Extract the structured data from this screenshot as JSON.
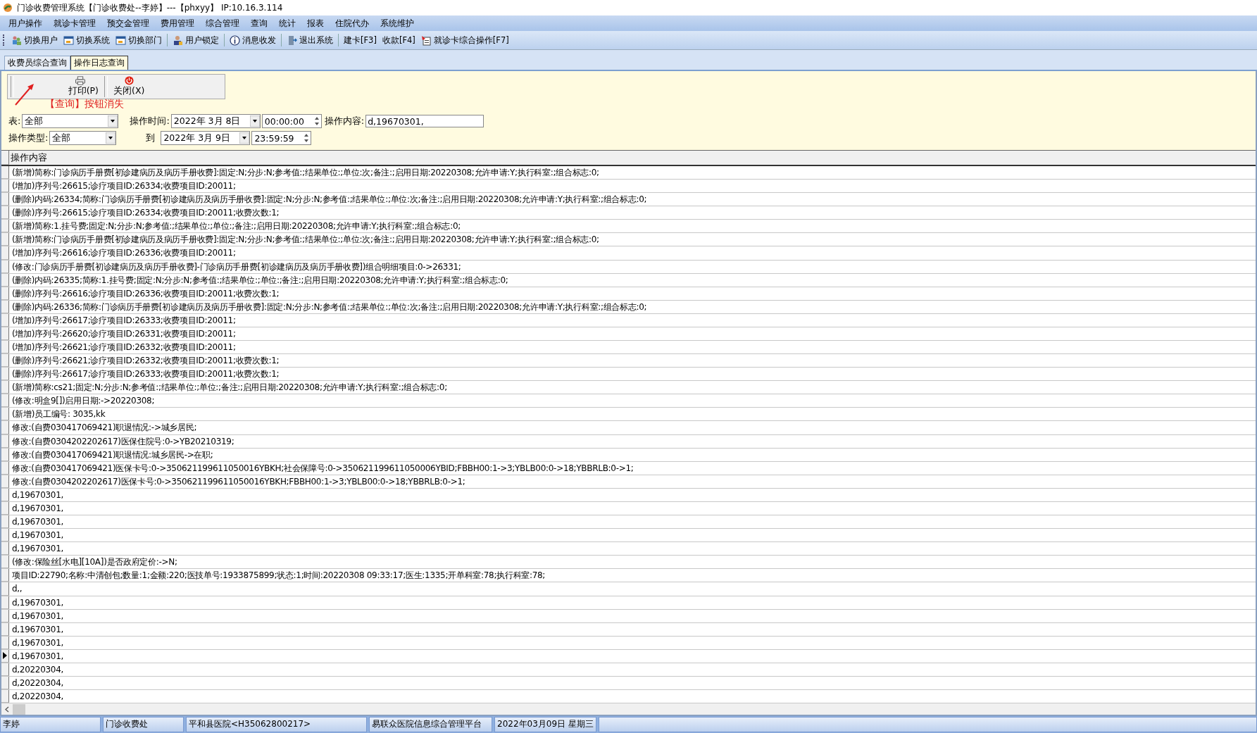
{
  "window": {
    "title": "门诊收费管理系统【门诊收费处--李婷】---【phxyy】 IP:10.16.3.114"
  },
  "menu": [
    "用户操作",
    "就诊卡管理",
    "预交金管理",
    "费用管理",
    "综合管理",
    "查询",
    "统计",
    "报表",
    "住院代办",
    "系统维护"
  ],
  "toolbar": [
    {
      "label": "切换用户",
      "kind": "icon"
    },
    {
      "label": "切换系统",
      "kind": "icon"
    },
    {
      "label": "切换部门",
      "kind": "icon"
    },
    {
      "label": "用户锁定",
      "kind": "icon"
    },
    {
      "label": "消息收发",
      "kind": "icon"
    },
    {
      "label": "退出系统",
      "kind": "icon"
    },
    {
      "label": "建卡[F3]",
      "kind": "text"
    },
    {
      "label": "收款[F4]",
      "kind": "text"
    },
    {
      "label": "就诊卡综合操作[F7]",
      "kind": "icon"
    }
  ],
  "tabs": [
    {
      "label": "收费员综合查询",
      "selected": false
    },
    {
      "label": "操作日志查询",
      "selected": true
    }
  ],
  "actions": [
    {
      "label": "打印(P)",
      "kind": "print"
    },
    {
      "label": "关闭(X)",
      "kind": "close"
    }
  ],
  "annotation": "【查询】按钮消失",
  "filters": {
    "table": {
      "label": "表:",
      "value": "全部"
    },
    "op_time": {
      "label": "操作时间:",
      "date": "2022年 3月 8日",
      "time": "00:00:00"
    },
    "content": {
      "label": "操作内容:",
      "value": "d,19670301,"
    },
    "op_type": {
      "label": "操作类型:",
      "value": "全部"
    },
    "to": {
      "label": "到",
      "date": "2022年 3月 9日",
      "time": "23:59:59"
    }
  },
  "grid": {
    "column": "操作内容",
    "rows": [
      {
        "text": "(新增)简称:门诊病历手册费[初诊建病历及病历手册收费]:固定:N;分步:N;参考值:;结果单位:;单位:次;备注:;启用日期:20220308;允许申请:Y;执行科室:;组合标志:0;",
        "current": false
      },
      {
        "text": "(增加)序列号:26615;诊疗项目ID:26334;收费项目ID:20011;",
        "current": false
      },
      {
        "text": "(删除)内码:26334;简称:门诊病历手册费[初诊建病历及病历手册收费]:固定:N;分步:N;参考值:;结果单位:;单位:次;备注:;启用日期:20220308;允许申请:Y;执行科室:;组合标志:0;",
        "current": false
      },
      {
        "text": "(删除)序列号:26615;诊疗项目ID:26334;收费项目ID:20011;收费次数:1;",
        "current": false
      },
      {
        "text": "(新增)简称:1.挂号费;固定:N;分步:N;参考值:;结果单位:;单位:;备注:;启用日期:20220308;允许申请:Y;执行科室:;组合标志:0;",
        "current": false
      },
      {
        "text": "(新增)简称:门诊病历手册费[初诊建病历及病历手册收费]:固定:N;分步:N;参考值:;结果单位:;单位:次;备注:;启用日期:20220308;允许申请:Y;执行科室:;组合标志:0;",
        "current": false
      },
      {
        "text": "(增加)序列号:26616;诊疗项目ID:26336;收费项目ID:20011;",
        "current": false
      },
      {
        "text": "(修改:门诊病历手册费[初诊建病历及病历手册收费]-门诊病历手册费[初诊建病历及病历手册收费])组合明细项目:0->26331;",
        "current": false
      },
      {
        "text": "(删除)内码:26335;简称:1.挂号费;固定:N;分步:N;参考值:;结果单位:;单位:;备注:;启用日期:20220308;允许申请:Y;执行科室:;组合标志:0;",
        "current": false
      },
      {
        "text": "(删除)序列号:26616;诊疗项目ID:26336;收费项目ID:20011;收费次数:1;",
        "current": false
      },
      {
        "text": "(删除)内码:26336;简称:门诊病历手册费[初诊建病历及病历手册收费]:固定:N;分步:N;参考值:;结果单位:;单位:次;备注:;启用日期:20220308;允许申请:Y;执行科室:;组合标志:0;",
        "current": false
      },
      {
        "text": "(增加)序列号:26617;诊疗项目ID:26333;收费项目ID:20011;",
        "current": false
      },
      {
        "text": "(增加)序列号:26620;诊疗项目ID:26331;收费项目ID:20011;",
        "current": false
      },
      {
        "text": "(增加)序列号:26621;诊疗项目ID:26332;收费项目ID:20011;",
        "current": false
      },
      {
        "text": "(删除)序列号:26621;诊疗项目ID:26332;收费项目ID:20011;收费次数:1;",
        "current": false
      },
      {
        "text": "(删除)序列号:26617;诊疗项目ID:26333;收费项目ID:20011;收费次数:1;",
        "current": false
      },
      {
        "text": "(新增)简称:cs21;固定:N;分步:N;参考值:;结果单位:;单位:;备注:;启用日期:20220308;允许申请:Y;执行科室:;组合标志:0;",
        "current": false
      },
      {
        "text": "(修改:明盒9[])启用日期:->20220308;",
        "current": false
      },
      {
        "text": "(新增)员工编号: 3035,kk",
        "current": false
      },
      {
        "text": "修改:(自费030417069421)职退情况:->城乡居民;",
        "current": false
      },
      {
        "text": "修改:(自费0304202202617)医保住院号:0->YB20210319;",
        "current": false
      },
      {
        "text": "修改:(自费030417069421)职退情况:城乡居民->在职;",
        "current": false
      },
      {
        "text": "修改:(自费030417069421)医保卡号:0->350621199611050016YBKH;社会保障号:0->350621199611050006YBID;FBBH00:1->3;YBLB00:0->18;YBBRLB:0->1;",
        "current": false
      },
      {
        "text": "修改:(自费0304202202617)医保卡号:0->350621199611050016YBKH;FBBH00:1->3;YBLB00:0->18;YBBRLB:0->1;",
        "current": false
      },
      {
        "text": "d,19670301,",
        "current": false
      },
      {
        "text": "d,19670301,",
        "current": false
      },
      {
        "text": "d,19670301,",
        "current": false
      },
      {
        "text": "d,19670301,",
        "current": false
      },
      {
        "text": "d,19670301,",
        "current": false
      },
      {
        "text": "(修改:保险丝[水电][10A])是否政府定价:->N;",
        "current": false
      },
      {
        "text": "项目ID:22790;名称:中清创包;数量:1;金额:220;医技单号:1933875899;状态:1;时间:20220308 09:33:17;医生:1335;开单科室:78;执行科室:78;",
        "current": false
      },
      {
        "text": "d,,",
        "current": false
      },
      {
        "text": "d,19670301,",
        "current": false
      },
      {
        "text": "d,19670301,",
        "current": false
      },
      {
        "text": "d,19670301,",
        "current": false
      },
      {
        "text": "d,19670301,",
        "current": false
      },
      {
        "text": "d,19670301,",
        "current": true
      },
      {
        "text": "d,20220304,",
        "current": false
      },
      {
        "text": "d,20220304,",
        "current": false
      },
      {
        "text": "d,20220304,",
        "current": false
      }
    ]
  },
  "status_bar": [
    "李婷",
    "门诊收费处",
    "平和县医院<H35062800217>",
    "易联众医院信息综合管理平台",
    "2022年03月09日 星期三"
  ]
}
